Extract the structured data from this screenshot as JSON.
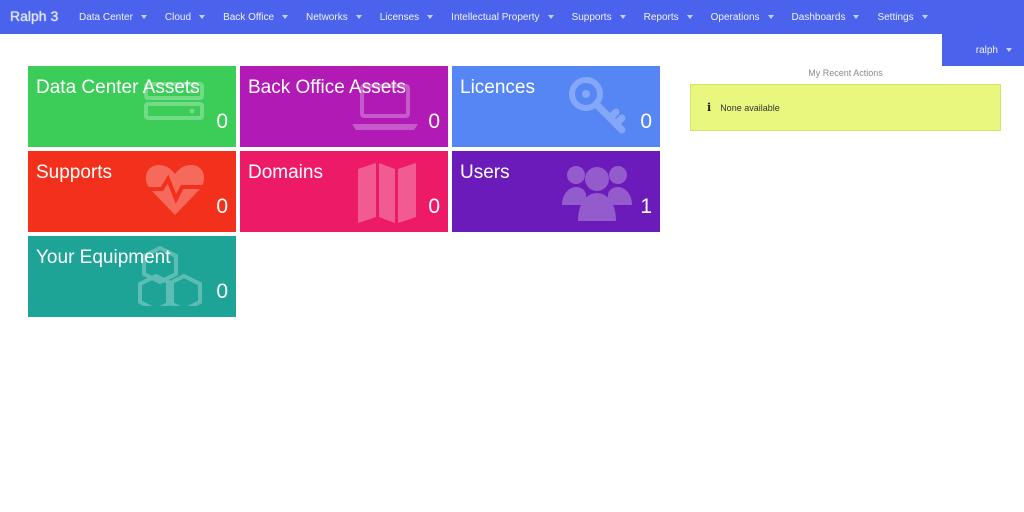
{
  "header": {
    "brand": "Ralph 3",
    "nav": [
      {
        "label": "Data Center"
      },
      {
        "label": "Cloud"
      },
      {
        "label": "Back Office"
      },
      {
        "label": "Networks"
      },
      {
        "label": "Licenses"
      },
      {
        "label": "Intellectual Property"
      },
      {
        "label": "Supports"
      },
      {
        "label": "Reports"
      },
      {
        "label": "Operations"
      },
      {
        "label": "Dashboards"
      },
      {
        "label": "Settings"
      }
    ],
    "user": "ralph"
  },
  "tiles": [
    {
      "title": "Data Center Assets",
      "count": "0",
      "color": "#3bcd58",
      "icon": "server-icon"
    },
    {
      "title": "Back Office Assets",
      "count": "0",
      "color": "#b21ab6",
      "icon": "laptop-icon"
    },
    {
      "title": "Licences",
      "count": "0",
      "color": "#5586f4",
      "icon": "key-icon"
    },
    {
      "title": "Supports",
      "count": "0",
      "color": "#f3301b",
      "icon": "heartbeat-icon"
    },
    {
      "title": "Domains",
      "count": "0",
      "color": "#ed1b67",
      "icon": "map-icon"
    },
    {
      "title": "Users",
      "count": "1",
      "color": "#6b1bb9",
      "icon": "users-icon"
    },
    {
      "title": "Your Equipment",
      "count": "0",
      "color": "#1ea497",
      "icon": "cubes-icon"
    }
  ],
  "recent_actions": {
    "title": "My Recent Actions",
    "empty_text": "None available",
    "box_color": "#eaf77f"
  }
}
